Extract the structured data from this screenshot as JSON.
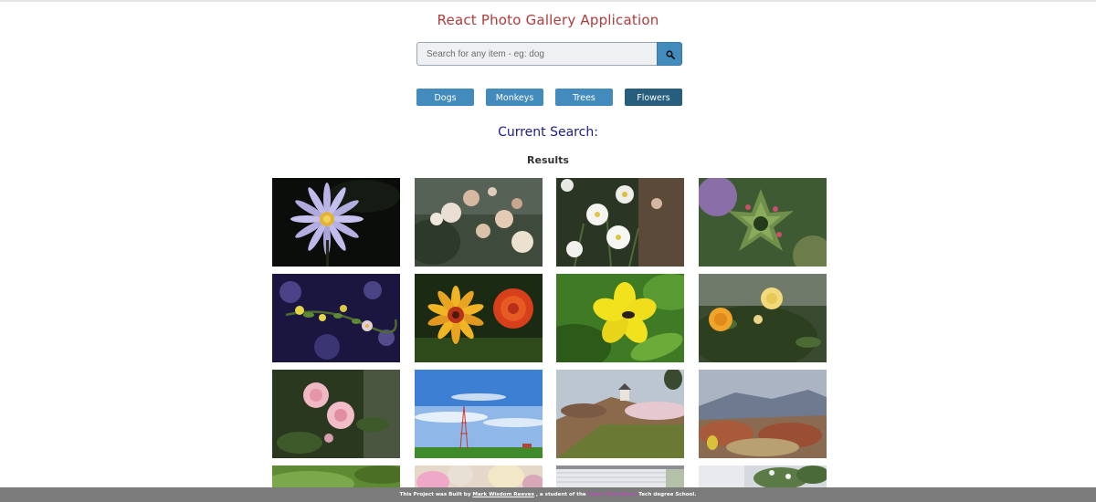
{
  "header": {
    "title": "React Photo Gallery Application"
  },
  "search": {
    "placeholder": "Search for any item - eg: dog",
    "value": ""
  },
  "nav": [
    {
      "label": "Dogs",
      "active": false
    },
    {
      "label": "Monkeys",
      "active": false
    },
    {
      "label": "Trees",
      "active": false
    },
    {
      "label": "Flowers",
      "active": true
    }
  ],
  "current_search": {
    "label": "Current Search:",
    "value": ""
  },
  "results": {
    "heading": "Results"
  },
  "photos": [
    {
      "subject": "purple water lily"
    },
    {
      "subject": "pale pink carnations"
    },
    {
      "subject": "white cosmos"
    },
    {
      "subject": "green succulent"
    },
    {
      "subject": "small yellow flowers on dark branch"
    },
    {
      "subject": "orange red gerbera daisies"
    },
    {
      "subject": "yellow lily with bee"
    },
    {
      "subject": "yellow and orange roses"
    },
    {
      "subject": "pink roses"
    },
    {
      "subject": "blue sky with tower"
    },
    {
      "subject": "hillside castle with trees"
    },
    {
      "subject": "mountain landscape"
    },
    {
      "subject": "green foliage"
    },
    {
      "subject": "pink lilies"
    },
    {
      "subject": "house eaves"
    },
    {
      "subject": "garden by house"
    }
  ],
  "footer": {
    "prefix": "This Project was Built by",
    "author": "Mark Wisdom Reeves",
    "middle": ", a student of the",
    "school": "Team Tree House",
    "suffix": "Tech degree School."
  },
  "colors": {
    "title": "#b03b3b",
    "button": "#438bbd",
    "button_active": "#275d7d",
    "current_search": "#1c1c8c",
    "footer_bg": "#7b7b7b",
    "footer_link": "#b64fb8"
  },
  "icons": {
    "search_button": "search-icon"
  }
}
